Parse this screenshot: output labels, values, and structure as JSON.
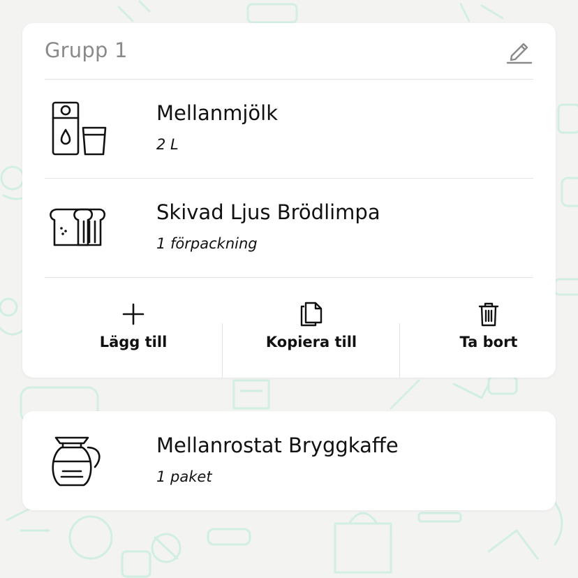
{
  "group": {
    "title": "Grupp 1",
    "items": [
      {
        "name": "Mellanmjölk",
        "quantity": "2 L",
        "icon": "milk-carton-glass-icon"
      },
      {
        "name": "Skivad Ljus Brödlimpa",
        "quantity": "1 förpackning",
        "icon": "sliced-bread-icon"
      }
    ],
    "actions": [
      {
        "label": "Lägg till",
        "icon": "plus-icon"
      },
      {
        "label": "Kopiera till",
        "icon": "copy-icon"
      },
      {
        "label": "Ta bort",
        "icon": "trash-icon"
      }
    ]
  },
  "single_item": {
    "name": "Mellanrostat Bryggkaffe",
    "quantity": "1 paket",
    "icon": "coffee-pot-icon"
  },
  "colors": {
    "background": "#f3f3f2",
    "card": "#ffffff",
    "group_title": "#8a8a8a",
    "text": "#111111",
    "pattern": "#bfe9d8"
  }
}
